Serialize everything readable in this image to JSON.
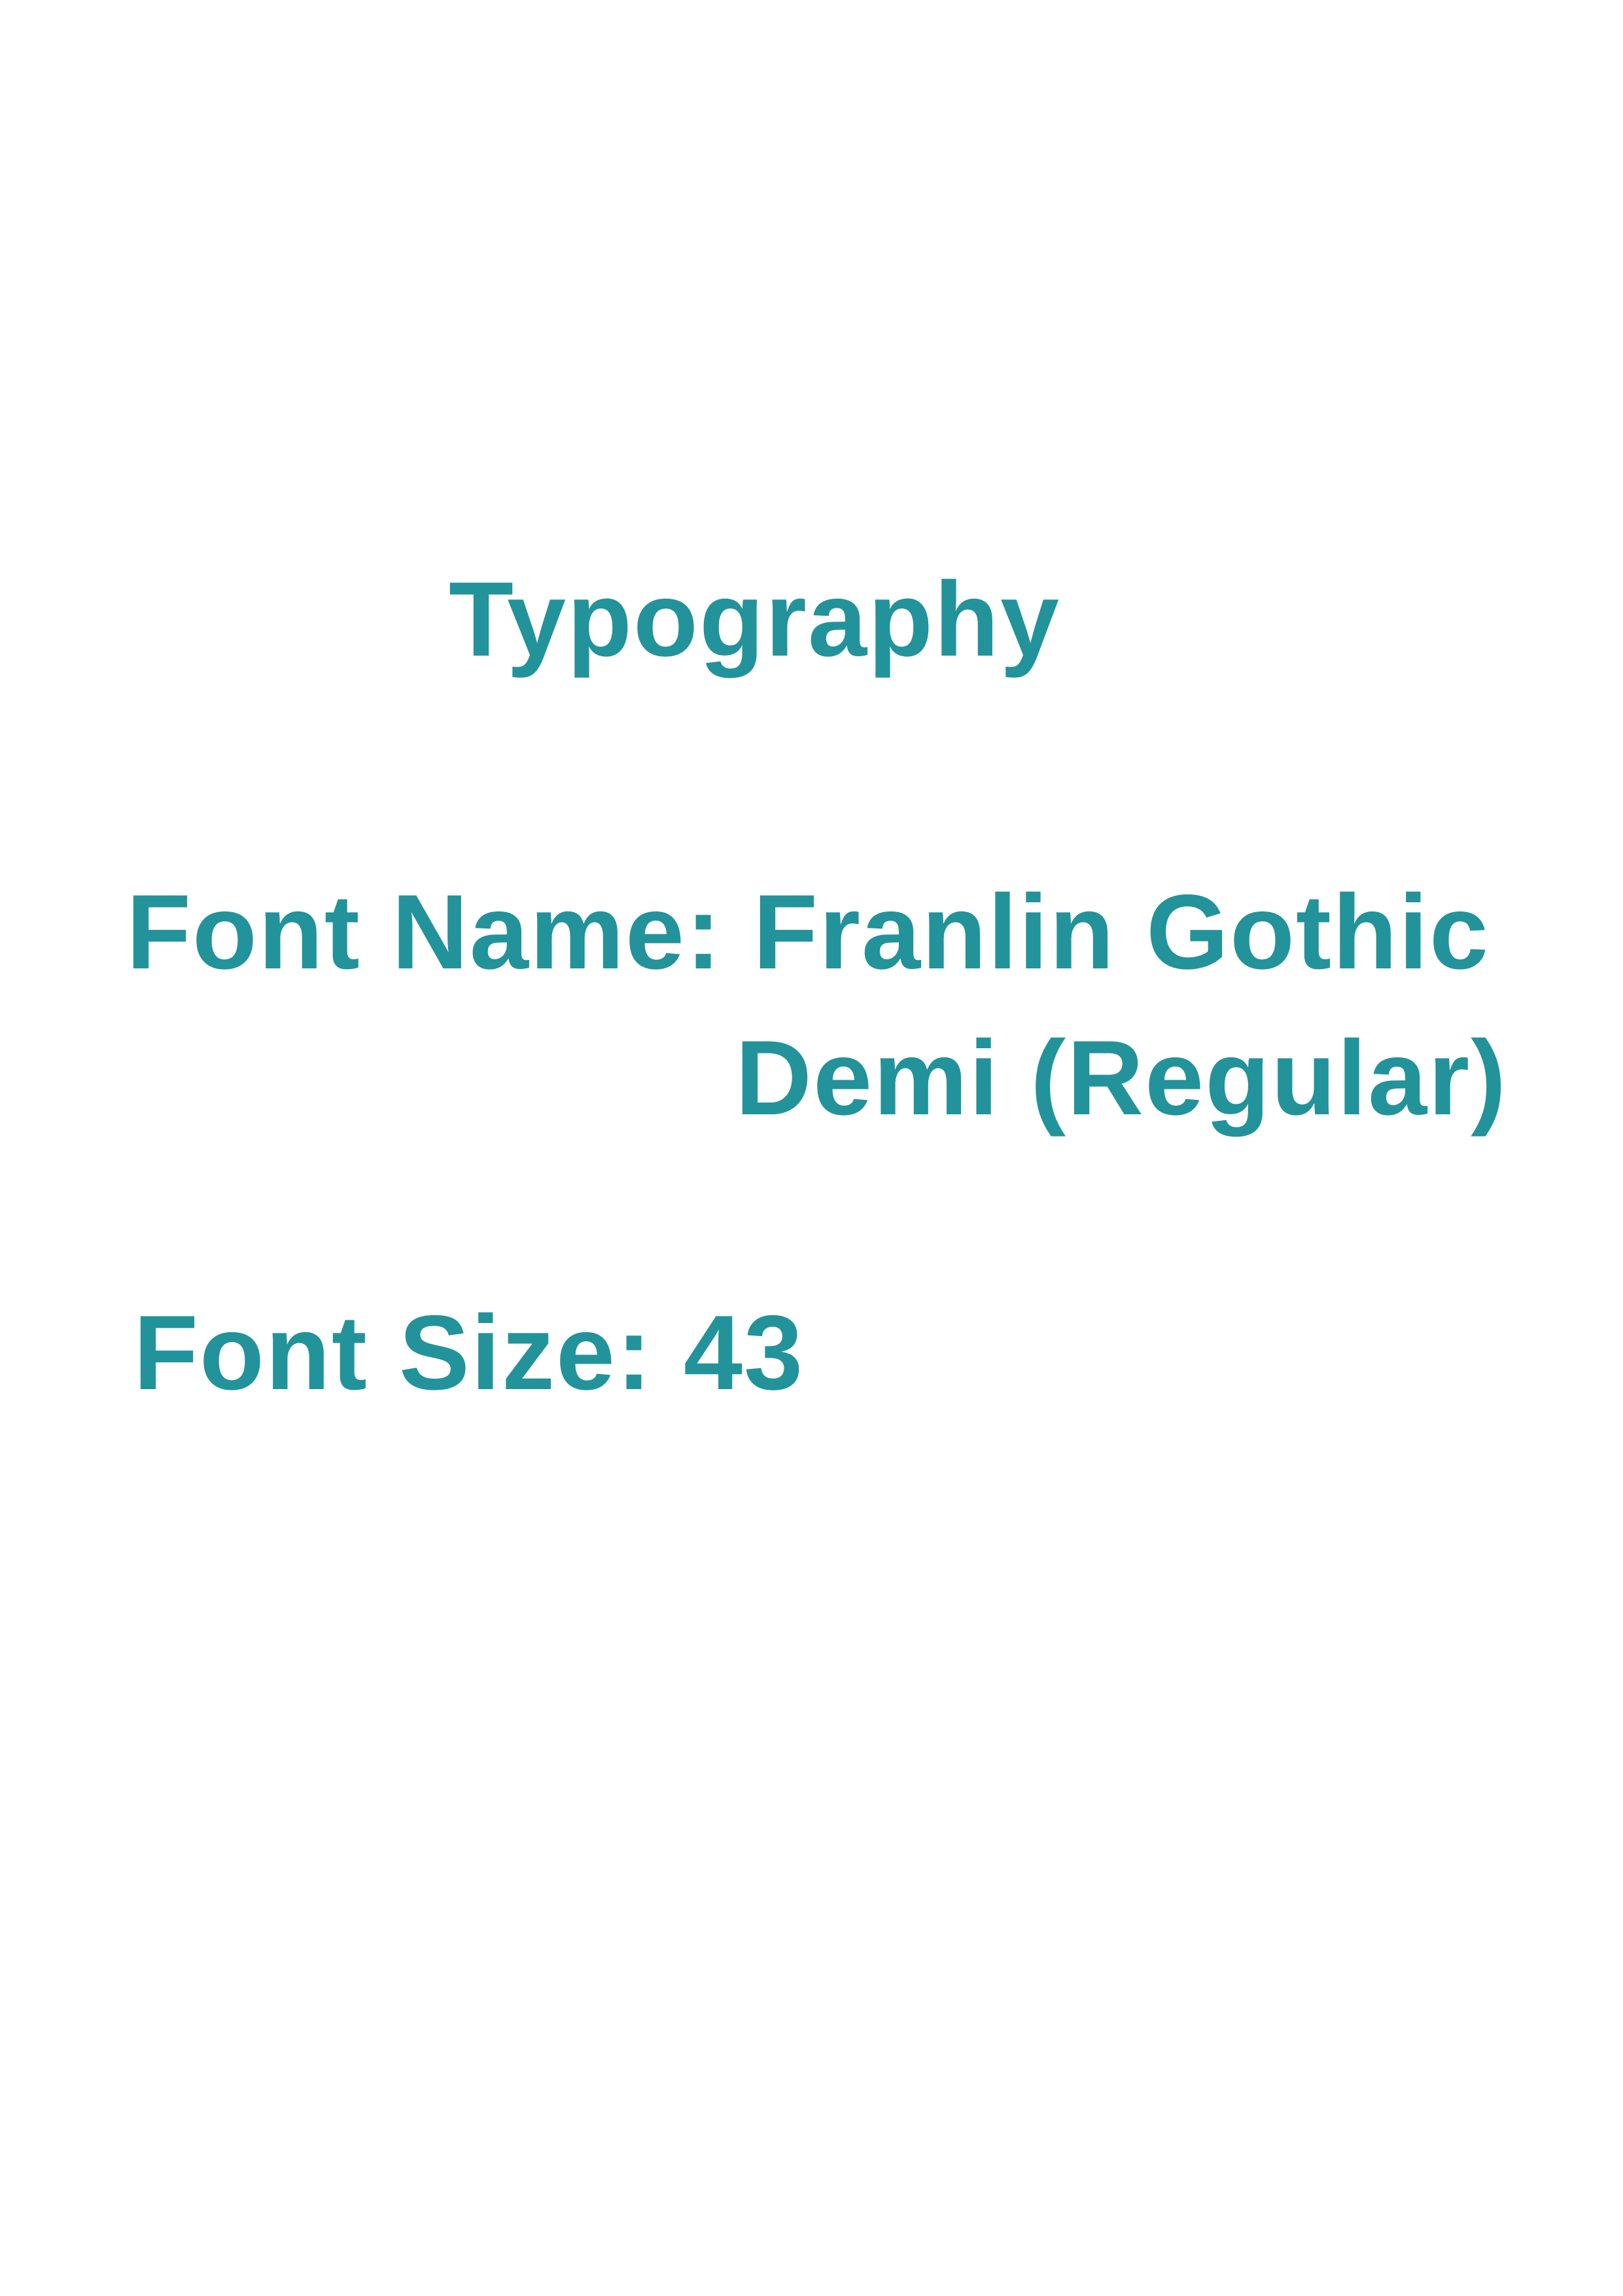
{
  "colors": {
    "accent": "#22939a",
    "background": "#ffffff"
  },
  "document": {
    "title": "Typography",
    "font_name_line1": "Font Name: Franlin Gothic",
    "font_name_line2": "Demi (Regular)",
    "font_size_line": "Font Size: 43"
  }
}
